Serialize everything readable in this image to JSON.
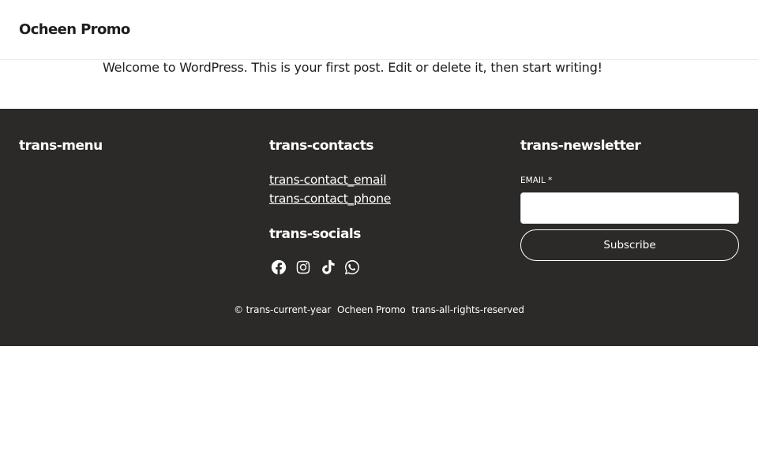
{
  "header": {
    "site_title": "Ocheen Promo"
  },
  "post": {
    "text": "Welcome to WordPress. This is your first post. Edit or delete it, then start writing!"
  },
  "footer": {
    "menu_heading": "trans-menu",
    "contacts_heading": "trans-contacts",
    "contact_email": "trans-contact_email",
    "contact_phone": "trans-contact_phone",
    "socials_heading": "trans-socials",
    "socials": [
      "facebook-icon",
      "instagram-icon",
      "tiktok-icon",
      "whatsapp-icon"
    ],
    "newsletter_heading": "trans-newsletter",
    "email_label": "EMAIL *",
    "email_value": "",
    "subscribe_label": "Subscribe",
    "copyright_year": "© trans-current-year",
    "copyright_name": "Ocheen Promo",
    "copyright_rights": "trans-all-rights-reserved"
  },
  "colors": {
    "footer_bg": "#2b2a28",
    "text": "#1e1e1e",
    "footer_text": "#ffffff"
  }
}
